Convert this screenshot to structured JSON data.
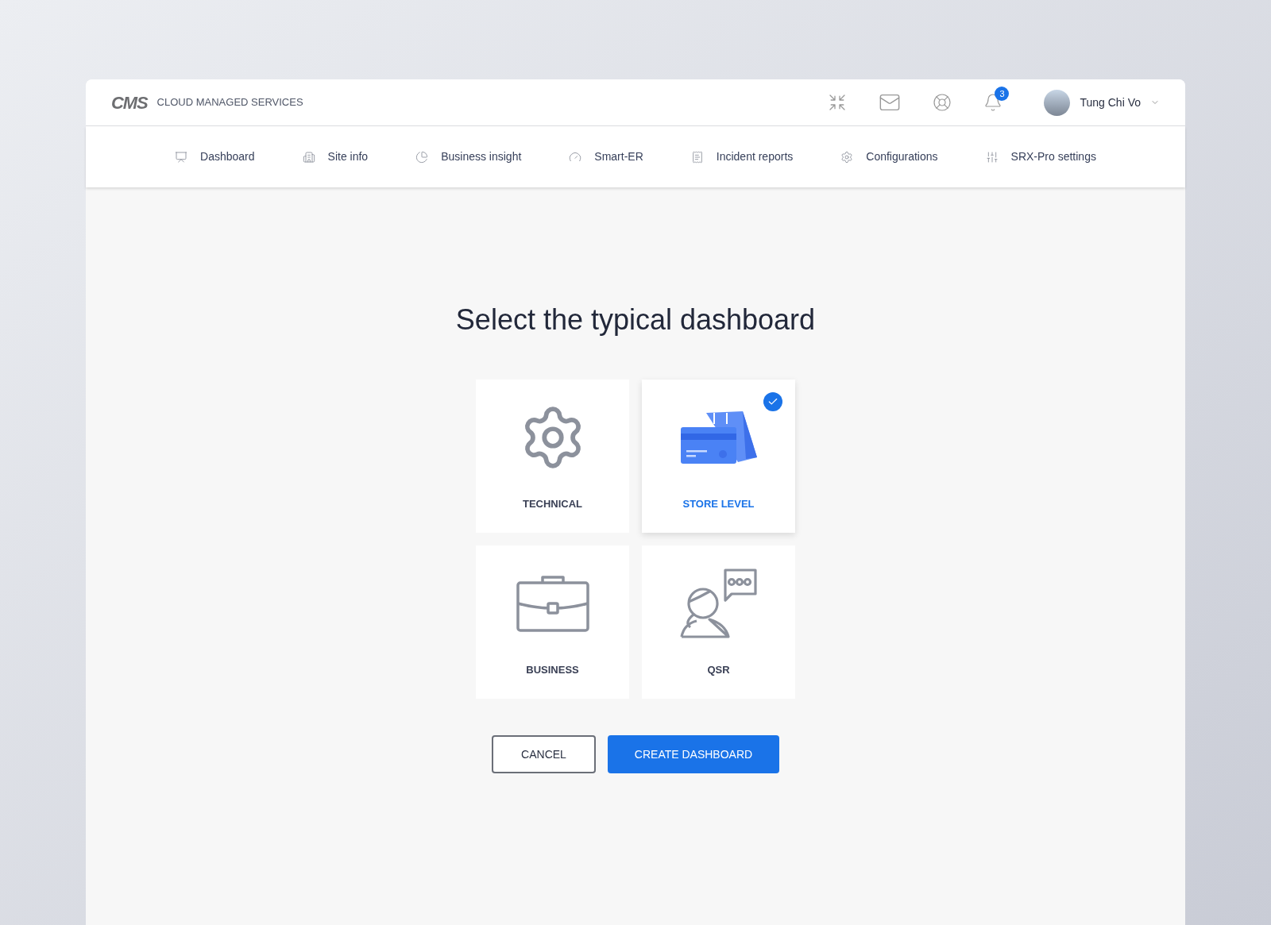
{
  "header": {
    "logo": "CMS",
    "brand": "CLOUD MANAGED SERVICES",
    "notifications": "3",
    "user": "Tung Chi Vo"
  },
  "nav": [
    {
      "label": "Dashboard",
      "kind": "presentation"
    },
    {
      "label": "Site info",
      "kind": "building"
    },
    {
      "label": "Business insight",
      "kind": "pie"
    },
    {
      "label": "Smart-ER",
      "kind": "gauge"
    },
    {
      "label": "Incident reports",
      "kind": "receipt"
    },
    {
      "label": "Configurations",
      "kind": "gear"
    },
    {
      "label": "SRX-Pro settings",
      "kind": "sliders"
    }
  ],
  "title": "Select the typical dashboard",
  "options": [
    {
      "label": "TECHNICAL",
      "kind": "gear",
      "selected": false
    },
    {
      "label": "STORE LEVEL",
      "kind": "store",
      "selected": true
    },
    {
      "label": "BUSINESS",
      "kind": "briefcase",
      "selected": false
    },
    {
      "label": "QSR",
      "kind": "agent",
      "selected": false
    }
  ],
  "buttons": {
    "cancel": "CANCEL",
    "create": "CREATE DASHBOARD"
  }
}
